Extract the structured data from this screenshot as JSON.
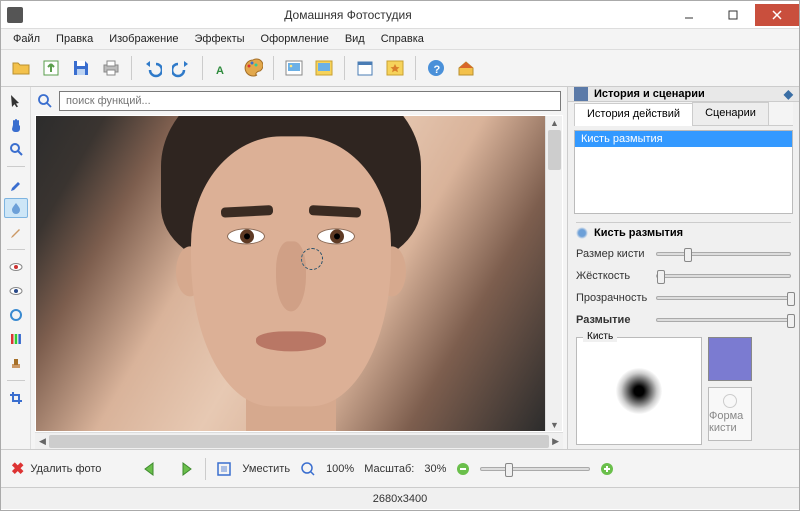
{
  "window": {
    "title": "Домашняя Фотостудия"
  },
  "menu": {
    "file": "Файл",
    "edit": "Правка",
    "image": "Изображение",
    "effects": "Эффекты",
    "design": "Оформление",
    "view": "Вид",
    "help": "Справка"
  },
  "search": {
    "placeholder": "поиск функций..."
  },
  "history_panel": {
    "title": "История и сценарии",
    "tab_history": "История действий",
    "tab_scenarios": "Сценарии",
    "items": [
      "Кисть размытия"
    ]
  },
  "tool_panel": {
    "title": "Кисть размытия",
    "params": {
      "size": "Размер кисти",
      "hardness": "Жёсткость",
      "opacity": "Прозрачность",
      "blur": "Размытие"
    },
    "brush_label": "Кисть",
    "shape_label": "Форма кисти",
    "color": "#7b7bd1",
    "slider_pos": {
      "size": 20,
      "hardness": 0,
      "opacity": 98,
      "blur": 98
    }
  },
  "action_bar": {
    "delete": "Удалить фото",
    "fit": "Уместить",
    "zoom_100": "100%",
    "scale_label": "Масштаб:",
    "scale_value": "30%",
    "zoom_knob": 22
  },
  "status": {
    "dimensions": "2680x3400"
  }
}
